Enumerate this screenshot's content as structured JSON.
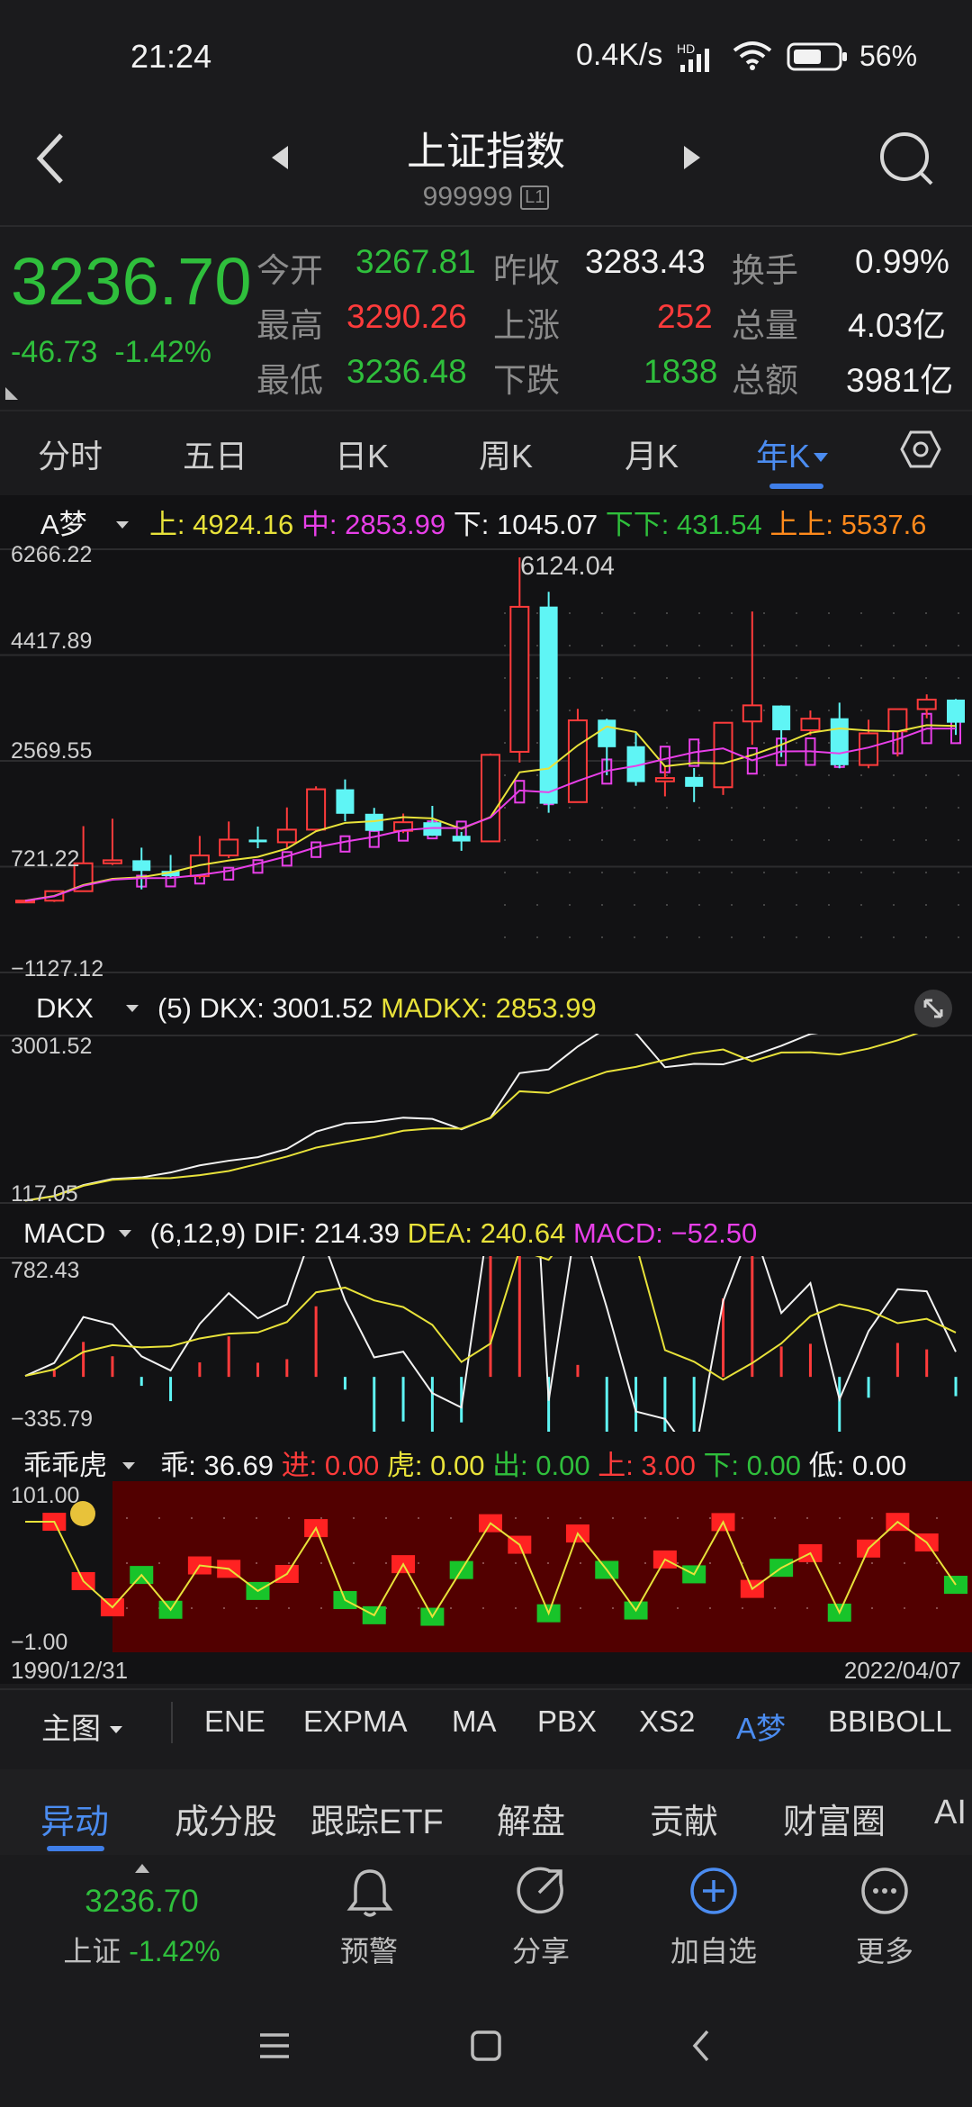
{
  "status_bar": {
    "time": "21:24",
    "net_speed": "0.4K/s",
    "network_badge": "HD",
    "battery": "56%"
  },
  "header": {
    "title": "上证指数",
    "code": "999999",
    "level_badge": "L1"
  },
  "quote": {
    "price": "3236.70",
    "change": "-46.73",
    "change_pct": "-1.42%",
    "open_label": "今开",
    "open": "3267.81",
    "prev_close_label": "昨收",
    "prev_close": "3283.43",
    "turnover_label": "换手",
    "turnover": "0.99%",
    "high_label": "最高",
    "high": "3290.26",
    "up_label": "上涨",
    "up": "252",
    "volume_label": "总量",
    "volume": "4.03亿",
    "low_label": "最低",
    "low": "3236.48",
    "down_label": "下跌",
    "down": "1838",
    "amount_label": "总额",
    "amount": "3981亿"
  },
  "period_tabs": [
    "分时",
    "五日",
    "日K",
    "周K",
    "月K",
    "年K"
  ],
  "active_period": "年K",
  "main_indicator": {
    "name": "A梦",
    "upper": "上: 4924.16",
    "mid": "中: 2853.99",
    "lower": "下: 1045.07",
    "lower2": "下下: 431.54",
    "upper2": "上上: 5537.6",
    "y_labels": [
      "6266.22",
      "4417.89",
      "2569.55",
      "721.22",
      "−1127.12"
    ],
    "peak_label": "6124.04"
  },
  "dkx": {
    "name": "DKX",
    "params": "(5)",
    "dkx": "DKX: 3001.52",
    "madkx": "MADKX: 2853.99",
    "y_top": "3001.52",
    "y_bottom": "117.05"
  },
  "macd": {
    "name": "MACD",
    "params": "(6,12,9)",
    "dif": "DIF: 214.39",
    "dea": "DEA: 240.64",
    "macd": "MACD: −52.50",
    "y_top": "782.43",
    "y_bottom": "−335.79"
  },
  "gguaihu": {
    "name": "乖乖虎",
    "guai": "乖: 36.69",
    "jin": "进: 0.00",
    "hu": "虎: 0.00",
    "chu": "出: 0.00",
    "shang": "上: 3.00",
    "xia": "下: 0.00",
    "di": "低: 0.00",
    "y_top": "101.00",
    "y_bottom": "−1.00"
  },
  "dates": {
    "start": "1990/12/31",
    "end": "2022/04/07"
  },
  "indicator_tabs": [
    "主图",
    "ENE",
    "EXPMA",
    "MA",
    "PBX",
    "XS2",
    "A梦",
    "BBIBOLL"
  ],
  "active_indicator": "A梦",
  "section_tabs": [
    "异动",
    "成分股",
    "跟踪ETF",
    "解盘",
    "贡献",
    "财富圈",
    "AI"
  ],
  "active_section": "异动",
  "footer": {
    "price": "3236.70",
    "name": "上证",
    "pct": "-1.42%",
    "alert": "预警",
    "share": "分享",
    "add": "加自选",
    "more": "更多"
  },
  "colors": {
    "up": "#ff3b3b",
    "down": "#2fbf3c",
    "accent": "#4b8cf0",
    "bear_candle": "#5ff5f5"
  },
  "chart_data": {
    "type": "candlestick",
    "x": [
      1990,
      1991,
      1992,
      1993,
      1994,
      1995,
      1996,
      1997,
      1998,
      1999,
      2000,
      2001,
      2002,
      2003,
      2004,
      2005,
      2006,
      2007,
      2008,
      2009,
      2010,
      2011,
      2012,
      2013,
      2014,
      2015,
      2016,
      2017,
      2018,
      2019,
      2020,
      2021,
      2022
    ],
    "open": [
      96,
      127,
      293,
      780,
      833,
      647,
      555,
      917,
      1194,
      1147,
      1368,
      2073,
      1645,
      1347,
      1497,
      1261,
      1163,
      2728,
      5265,
      1849,
      3289,
      2825,
      2212,
      2289,
      2109,
      3258,
      3536,
      3105,
      3314,
      2497,
      3085,
      3474,
      3640
    ],
    "close": [
      128,
      293,
      780,
      833,
      647,
      555,
      917,
      1194,
      1147,
      1368,
      2073,
      1645,
      1347,
      1497,
      1261,
      1161,
      2675,
      5261,
      1820,
      3277,
      2808,
      2199,
      2269,
      2116,
      3235,
      3539,
      3104,
      3307,
      2494,
      3050,
      3473,
      3640,
      3236
    ],
    "high": [
      128,
      293,
      1429,
      1559,
      1053,
      926,
      1258,
      1510,
      1422,
      1756,
      2125,
      2245,
      1748,
      1649,
      1783,
      1328,
      2698,
      6124,
      5522,
      3478,
      3306,
      3067,
      2478,
      2444,
      3239,
      5178,
      3539,
      3450,
      3587,
      3288,
      3474,
      3731,
      3651
    ],
    "low": [
      96,
      105,
      386,
      750,
      325,
      524,
      513,
      870,
      1043,
      1047,
      1341,
      1514,
      1339,
      1307,
      1259,
      998,
      1161,
      2541,
      1664,
      1844,
      2319,
      2134,
      1949,
      1849,
      1974,
      2850,
      2638,
      3016,
      2440,
      2440,
      2646,
      3312,
      3023
    ]
  }
}
